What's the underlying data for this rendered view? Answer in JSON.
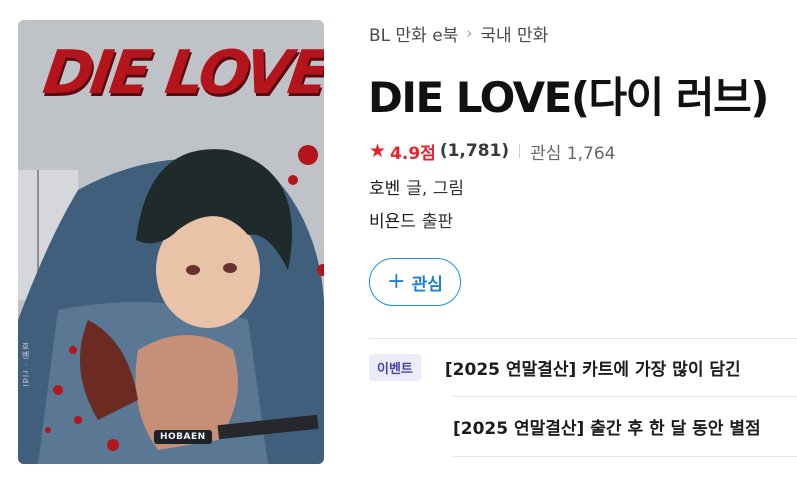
{
  "breadcrumb": {
    "category": "BL 만화 e북",
    "separator": "›",
    "subcategory": "국내 만화"
  },
  "book": {
    "title": "DIE LOVE(다이 러브)",
    "cover": {
      "title_art": "DIE LOVE",
      "author_tag": "HOBAEN",
      "side_text": "호벤 · ridi"
    },
    "rating": "4.9점",
    "rating_count": "(1,781)",
    "interest_label": "관심 1,764",
    "author_name": "호벤",
    "author_role": "글, 그림",
    "publisher_name": "비욘드",
    "publisher_role": "출판"
  },
  "follow_button": {
    "plus": "+",
    "label": "관심"
  },
  "events": {
    "badge": "이벤트",
    "items": [
      "[2025 연말결산] 카트에 가장 많이 담긴",
      "[2025 연말결산] 출간 후 한 달 동안 별점"
    ]
  },
  "colors": {
    "accent_red": "#e8232c",
    "follow_blue": "#1e7fd6",
    "event_badge_bg": "#ecebf9",
    "event_badge_text": "#4b45a3"
  },
  "icons": {
    "rating": "star-icon",
    "follow": "plus-icon",
    "breadcrumb": "chevron-right-icon"
  }
}
